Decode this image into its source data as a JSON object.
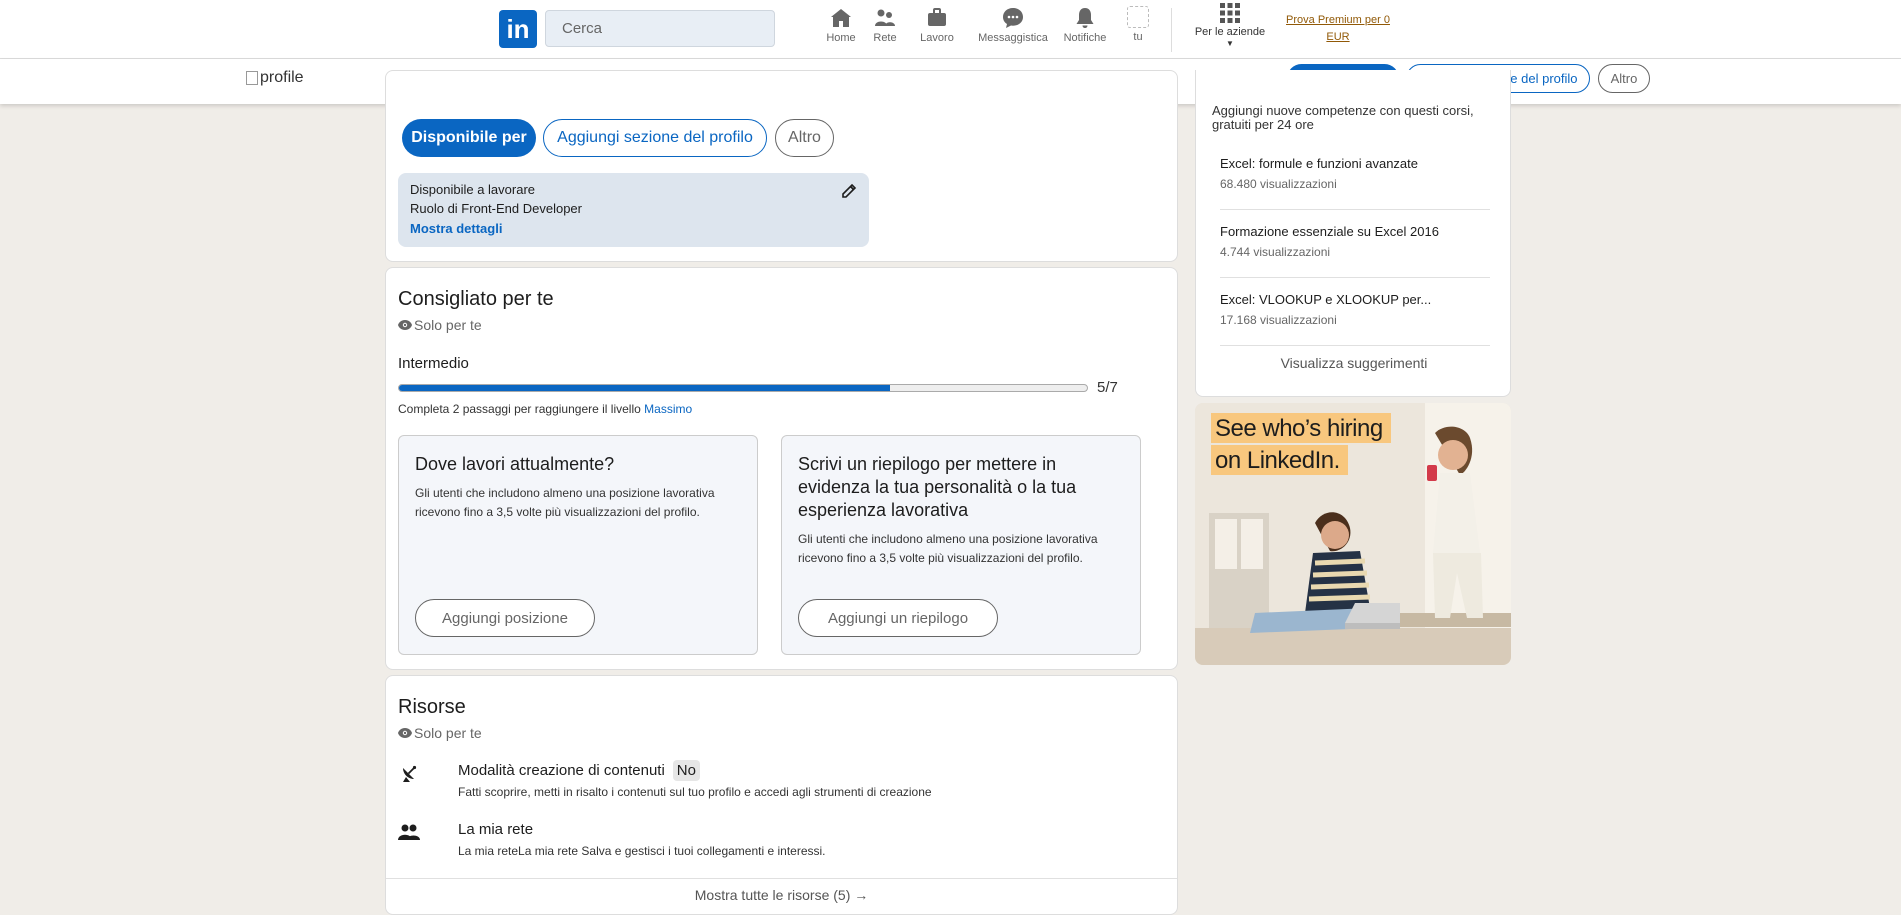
{
  "topnav": {
    "logo_text": "in",
    "search_placeholder": "Cerca",
    "items": [
      {
        "label": "Home",
        "icon": "home-icon"
      },
      {
        "label": "Rete",
        "icon": "network-icon"
      },
      {
        "label": "Lavoro",
        "icon": "briefcase-icon"
      },
      {
        "label": "Messaggistica",
        "icon": "messaging-icon"
      },
      {
        "label": "Notifiche",
        "icon": "bell-icon"
      }
    ],
    "me_label": "tu",
    "business_label": "Per le aziende",
    "premium_line1": "Prova Premium per 0",
    "premium_line2": "EUR"
  },
  "stickybar": {
    "profile_alt": "profile",
    "available_label": "Disponibile per",
    "add_section_label": "Aggiungi sezione del profilo",
    "more_label": "Altro"
  },
  "intro": {
    "available_label": "Disponibile per",
    "add_section_label": "Aggiungi sezione del profilo",
    "more_label": "Altro",
    "open_to_work": {
      "title": "Disponibile a lavorare",
      "role": "Ruolo di Front-End Developer",
      "details_link": "Mostra dettagli"
    }
  },
  "recommended": {
    "title": "Consigliato per te",
    "visibility": "Solo per te",
    "level": "Intermedio",
    "progress_current": 5,
    "progress_total": 7,
    "progress_label": "5/7",
    "hint_prefix": "Completa 2 passaggi per raggiungere il livello",
    "hint_level": "Massimo",
    "suggestions": [
      {
        "title": "Dove lavori attualmente?",
        "body": "Gli utenti che includono almeno una posizione lavorativa ricevono fino a 3,5 volte più visualizzazioni del profilo.",
        "button": "Aggiungi posizione"
      },
      {
        "title": "Scrivi un riepilogo per mettere in evidenza la tua personalità o la tua esperienza lavorativa",
        "body": "Gli utenti che includono almeno una posizione lavorativa ricevono fino a 3,5 volte più visualizzazioni del profilo.",
        "button": "Aggiungi un riepilogo"
      }
    ]
  },
  "resources": {
    "title": "Risorse",
    "visibility": "Solo per te",
    "items": [
      {
        "icon": "satellite-dish-icon",
        "title": "Modalità creazione di contenuti",
        "badge": "No",
        "desc": "Fatti scoprire, metti in risalto i contenuti sul tuo profilo e accedi agli strumenti di creazione"
      },
      {
        "icon": "people-icon",
        "title": "La mia rete",
        "desc": "La mia reteLa mia rete Salva e gestisci i tuoi collegamenti e interessi."
      }
    ],
    "show_all": "Mostra tutte le risorse (5) →"
  },
  "learning": {
    "intro": "Aggiungi nuove competenze con questi corsi, gratuiti per 24 ore",
    "courses": [
      {
        "title": "Excel: formule e funzioni avanzate",
        "views": "68.480 visualizzazioni"
      },
      {
        "title": "Formazione essenziale su Excel 2016",
        "views": "4.744 visualizzazioni"
      },
      {
        "title": "Excel: VLOOKUP e XLOOKUP per...",
        "views": "17.168 visualizzazioni"
      }
    ],
    "show_more": "Visualizza suggerimenti"
  },
  "ad": {
    "headline_line1": "See who’s hiring",
    "headline_line2": "on LinkedIn."
  }
}
